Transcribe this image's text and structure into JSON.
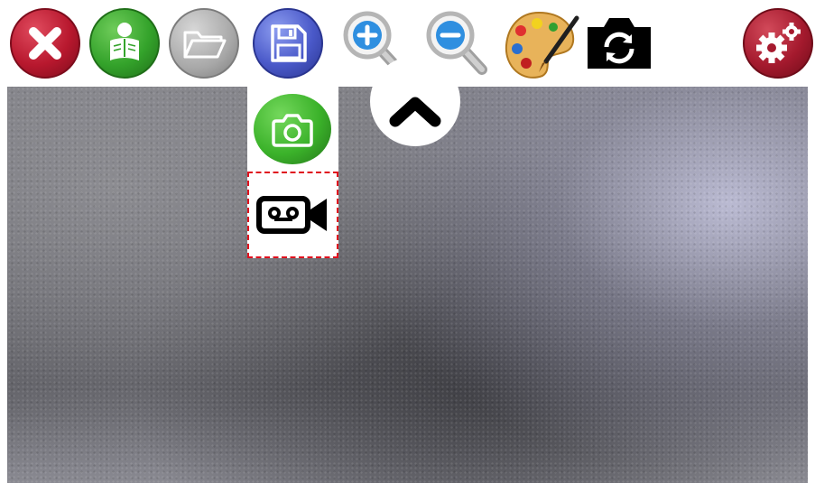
{
  "toolbar": {
    "buttons": [
      {
        "icon": "close-icon",
        "color": "#b8182e"
      },
      {
        "icon": "reader-icon",
        "color": "#34a32b"
      },
      {
        "icon": "folder-open-icon",
        "color": "#a8a8a8"
      },
      {
        "icon": "floppy-disk-icon",
        "color": "#4a59c9"
      },
      {
        "icon": "zoom-in-icon",
        "color": "#2f8fe0"
      },
      {
        "icon": "zoom-out-icon",
        "color": "#2f8fe0"
      },
      {
        "icon": "palette-icon",
        "color": "#d89a3a"
      },
      {
        "icon": "switch-camera-icon",
        "color": "#000000"
      },
      {
        "icon": "gears-icon",
        "color": "#a51a2e"
      }
    ]
  },
  "collapse": {
    "icon": "chevron-up-icon"
  },
  "capture_menu": {
    "photo": {
      "icon": "camera-icon",
      "color": "#3bb22a"
    },
    "video": {
      "icon": "video-camera-icon",
      "highlight_color": "#e0101e"
    }
  },
  "camera_view": {
    "content": "live-camera-feed"
  }
}
